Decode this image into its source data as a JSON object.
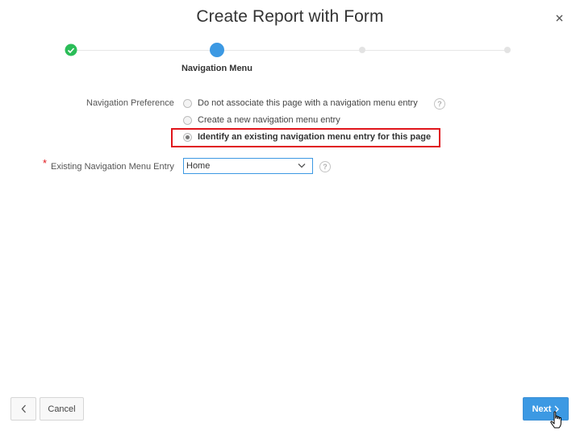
{
  "dialog": {
    "title": "Create Report with Form",
    "close_icon": "close-icon"
  },
  "wizard": {
    "steps": [
      {
        "status": "complete",
        "icon": "check-icon"
      },
      {
        "status": "current",
        "label": "Navigation Menu"
      },
      {
        "status": "upcoming"
      },
      {
        "status": "upcoming"
      }
    ],
    "current_label": "Navigation Menu"
  },
  "form": {
    "navigation_preference": {
      "label": "Navigation Preference",
      "options": [
        {
          "label": "Do not associate this page with a navigation menu entry",
          "checked": false
        },
        {
          "label": "Create a new navigation menu entry",
          "checked": false
        },
        {
          "label": "Identify an existing navigation menu entry for this page",
          "checked": true
        }
      ],
      "help_icon": "help-icon"
    },
    "existing_entry": {
      "label": "Existing Navigation Menu Entry",
      "required_marker": "*",
      "value": "Home",
      "help_icon": "help-icon"
    }
  },
  "footer": {
    "back_icon": "chevron-left-icon",
    "cancel_label": "Cancel",
    "next_label": "Next",
    "next_icon": "chevron-right-icon"
  },
  "colors": {
    "accent": "#3c99e3",
    "complete": "#2bbd58",
    "highlight": "#e0151b"
  }
}
